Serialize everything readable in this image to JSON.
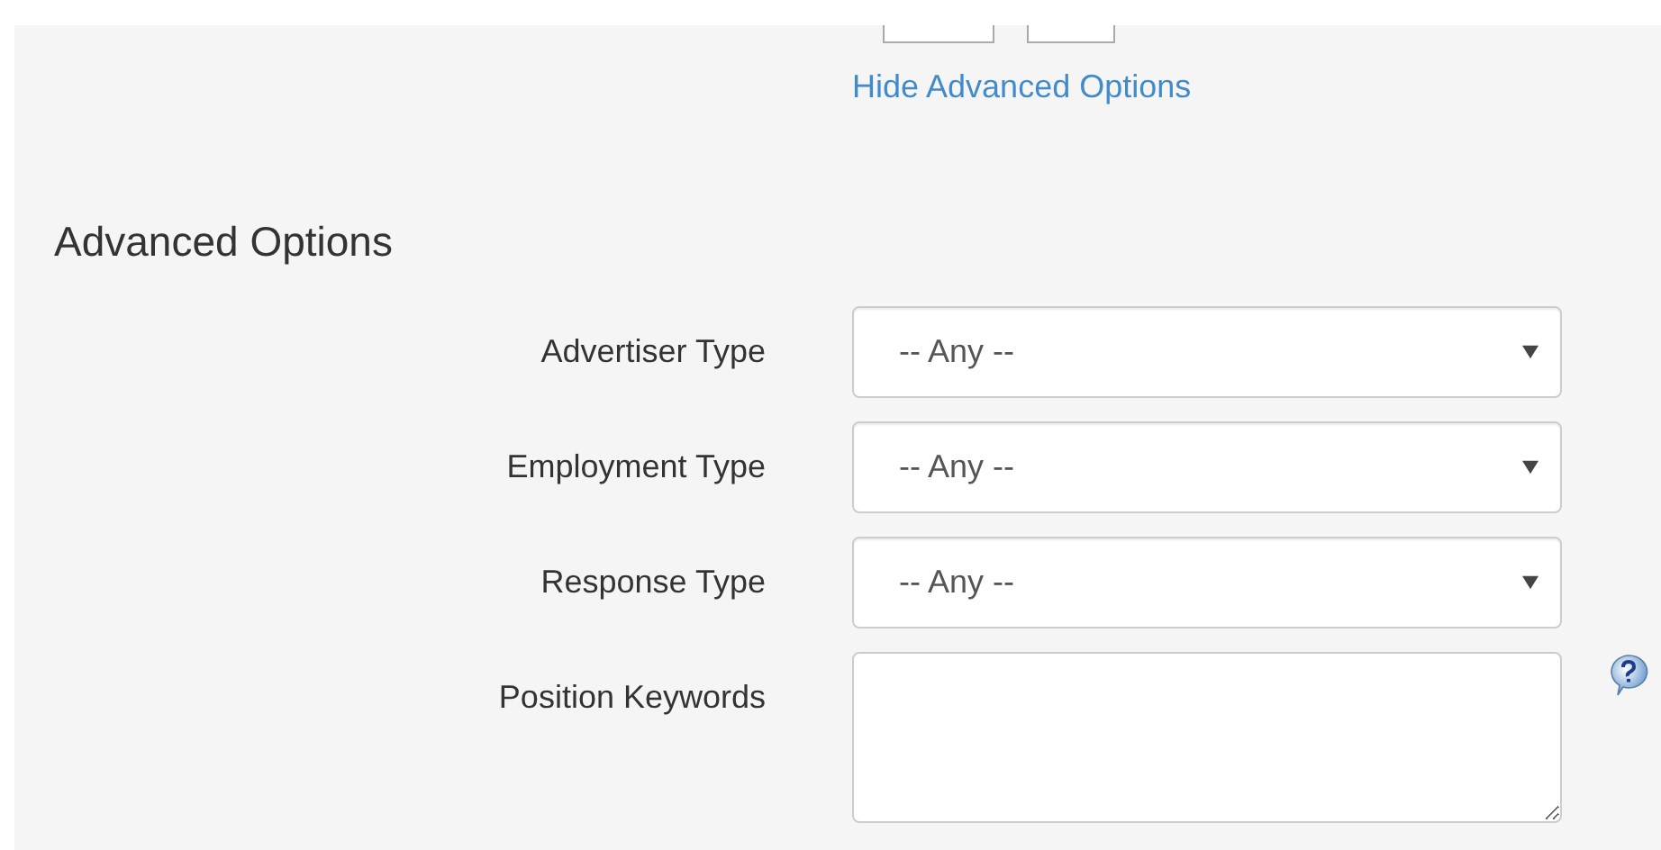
{
  "hide_link": "Hide Advanced Options",
  "section_title": "Advanced Options",
  "fields": [
    {
      "kind": "select",
      "label": "Advertiser Type",
      "value": "-- Any --"
    },
    {
      "kind": "select",
      "label": "Employment Type",
      "value": "-- Any --"
    },
    {
      "kind": "select",
      "label": "Response Type",
      "value": "-- Any --"
    },
    {
      "kind": "textarea",
      "label": "Position Keywords",
      "help": true
    }
  ]
}
